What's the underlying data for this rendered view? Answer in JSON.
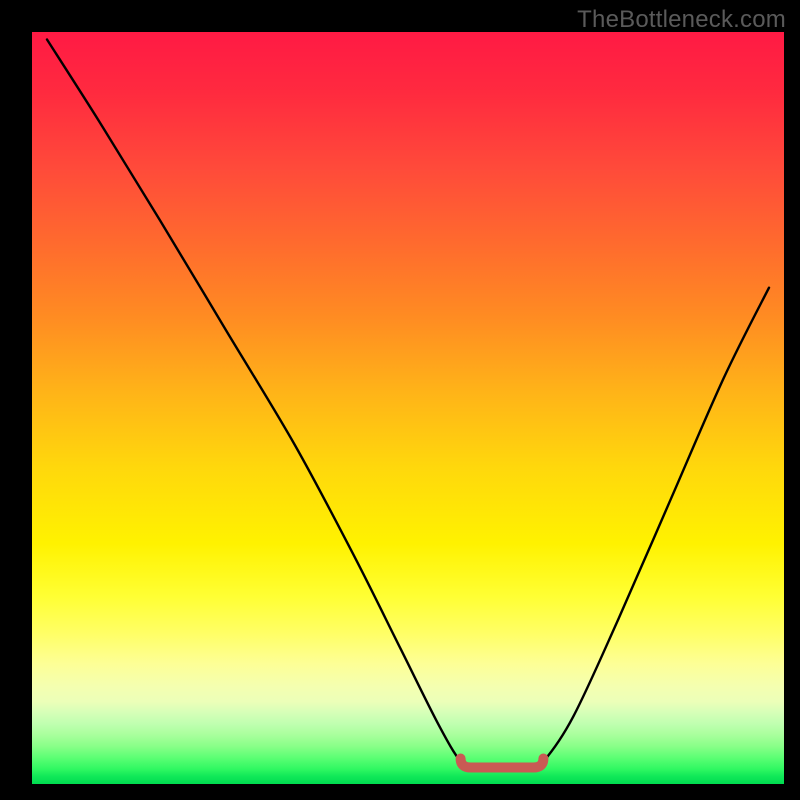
{
  "watermark_text": "TheBottleneck.com",
  "chart_data": {
    "type": "line",
    "title": "",
    "xlabel": "",
    "ylabel": "",
    "x_range": [
      0,
      100
    ],
    "y_range": [
      0,
      100
    ],
    "grid": false,
    "legend": false,
    "curve_points_pct": [
      [
        2,
        99
      ],
      [
        9,
        88
      ],
      [
        17,
        75
      ],
      [
        26,
        60
      ],
      [
        35,
        45
      ],
      [
        43,
        30
      ],
      [
        49,
        18
      ],
      [
        54,
        8
      ],
      [
        57,
        3
      ],
      [
        59,
        2
      ],
      [
        62,
        2
      ],
      [
        66,
        2
      ],
      [
        68,
        3
      ],
      [
        72,
        9
      ],
      [
        78,
        22
      ],
      [
        85,
        38
      ],
      [
        92,
        54
      ],
      [
        98,
        66
      ]
    ],
    "flat_marker_pct": {
      "x_start": 57,
      "x_end": 68,
      "y": 2.2
    },
    "marker_color": "#c95a54",
    "curve_color": "#000000"
  }
}
